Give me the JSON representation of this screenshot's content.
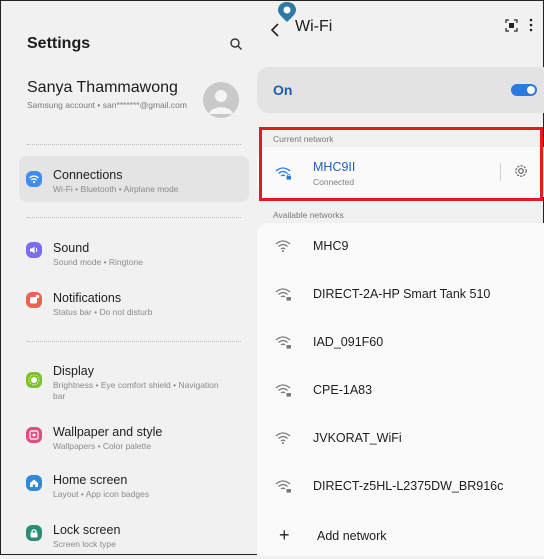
{
  "left": {
    "title": "Settings",
    "profile": {
      "name": "Sanya Thammawong",
      "account": "Samsung account • san*******@gmail.com"
    },
    "items": [
      {
        "label": "Connections",
        "sub": "Wi-Fi • Bluetooth • Airplane mode",
        "icon": "wifi-icon",
        "color": "#3d8ef0"
      },
      {
        "label": "Sound",
        "sub": "Sound mode • Ringtone",
        "icon": "speaker-icon",
        "color": "#7b6cf2"
      },
      {
        "label": "Notifications",
        "sub": "Status bar • Do not disturb",
        "icon": "notification-icon",
        "color": "#f06052"
      },
      {
        "label": "Display",
        "sub": "Brightness • Eye comfort shield • Navigation bar",
        "icon": "brightness-icon",
        "color": "#7dc12f"
      },
      {
        "label": "Wallpaper and style",
        "sub": "Wallpapers • Color palette",
        "icon": "wallpaper-icon",
        "color": "#e24d7d"
      },
      {
        "label": "Home screen",
        "sub": "Layout • App icon badges",
        "icon": "home-icon",
        "color": "#2f8bd8"
      },
      {
        "label": "Lock screen",
        "sub": "Screen lock type",
        "icon": "lock-icon",
        "color": "#2b8d73"
      }
    ]
  },
  "right": {
    "title": "Wi-Fi",
    "on_label": "On",
    "toggle_on": true,
    "current_label": "Current network",
    "current": {
      "name": "MHC9II",
      "status": "Connected"
    },
    "available_label": "Available networks",
    "networks": [
      {
        "name": "MHC9",
        "secured": false
      },
      {
        "name": "DIRECT-2A-HP Smart Tank 510",
        "secured": true
      },
      {
        "name": "IAD_091F60",
        "secured": true
      },
      {
        "name": "CPE-1A83",
        "secured": true
      },
      {
        "name": "JVKORAT_WiFi",
        "secured": false
      },
      {
        "name": "DIRECT-z5HL-L2375DW_BR916c",
        "secured": true
      }
    ],
    "add_label": "Add network"
  }
}
